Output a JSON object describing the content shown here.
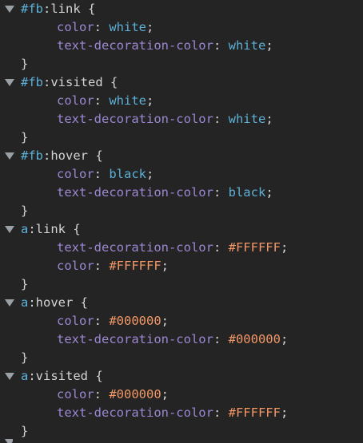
{
  "rules": [
    {
      "selector": "#fb",
      "pseudo": ":link",
      "declarations": [
        {
          "prop": "color",
          "value": "white",
          "kind": "keyword"
        },
        {
          "prop": "text-decoration-color",
          "value": "white",
          "kind": "keyword"
        }
      ]
    },
    {
      "selector": "#fb",
      "pseudo": ":visited",
      "declarations": [
        {
          "prop": "color",
          "value": "white",
          "kind": "keyword"
        },
        {
          "prop": "text-decoration-color",
          "value": "white",
          "kind": "keyword"
        }
      ]
    },
    {
      "selector": "#fb",
      "pseudo": ":hover",
      "declarations": [
        {
          "prop": "color",
          "value": "black",
          "kind": "keyword"
        },
        {
          "prop": "text-decoration-color",
          "value": "black",
          "kind": "keyword"
        }
      ]
    },
    {
      "selector": "a",
      "pseudo": ":link",
      "declarations": [
        {
          "prop": "text-decoration-color",
          "value": "#FFFFFF",
          "kind": "hex"
        },
        {
          "prop": "color",
          "value": "#FFFFFF",
          "kind": "hex"
        }
      ]
    },
    {
      "selector": "a",
      "pseudo": ":hover",
      "declarations": [
        {
          "prop": "color",
          "value": "#000000",
          "kind": "hex"
        },
        {
          "prop": "text-decoration-color",
          "value": "#000000",
          "kind": "hex"
        }
      ]
    },
    {
      "selector": "a",
      "pseudo": ":visited",
      "declarations": [
        {
          "prop": "color",
          "value": "#000000",
          "kind": "hex"
        },
        {
          "prop": "text-decoration-color",
          "value": "#FFFFFF",
          "kind": "hex"
        }
      ]
    }
  ],
  "punctuation": {
    "open": " {",
    "colon": ": ",
    "semicolon": ";",
    "close": "}"
  },
  "icons": {
    "twisty": "disclosure-triangle-expanded-icon"
  },
  "colors": {
    "background": "#242424",
    "selector": "#5db0d7",
    "property": "#9d87d2",
    "keyword_value": "#5db0d7",
    "hex_value": "#f29766",
    "text": "#d4d4d4"
  }
}
